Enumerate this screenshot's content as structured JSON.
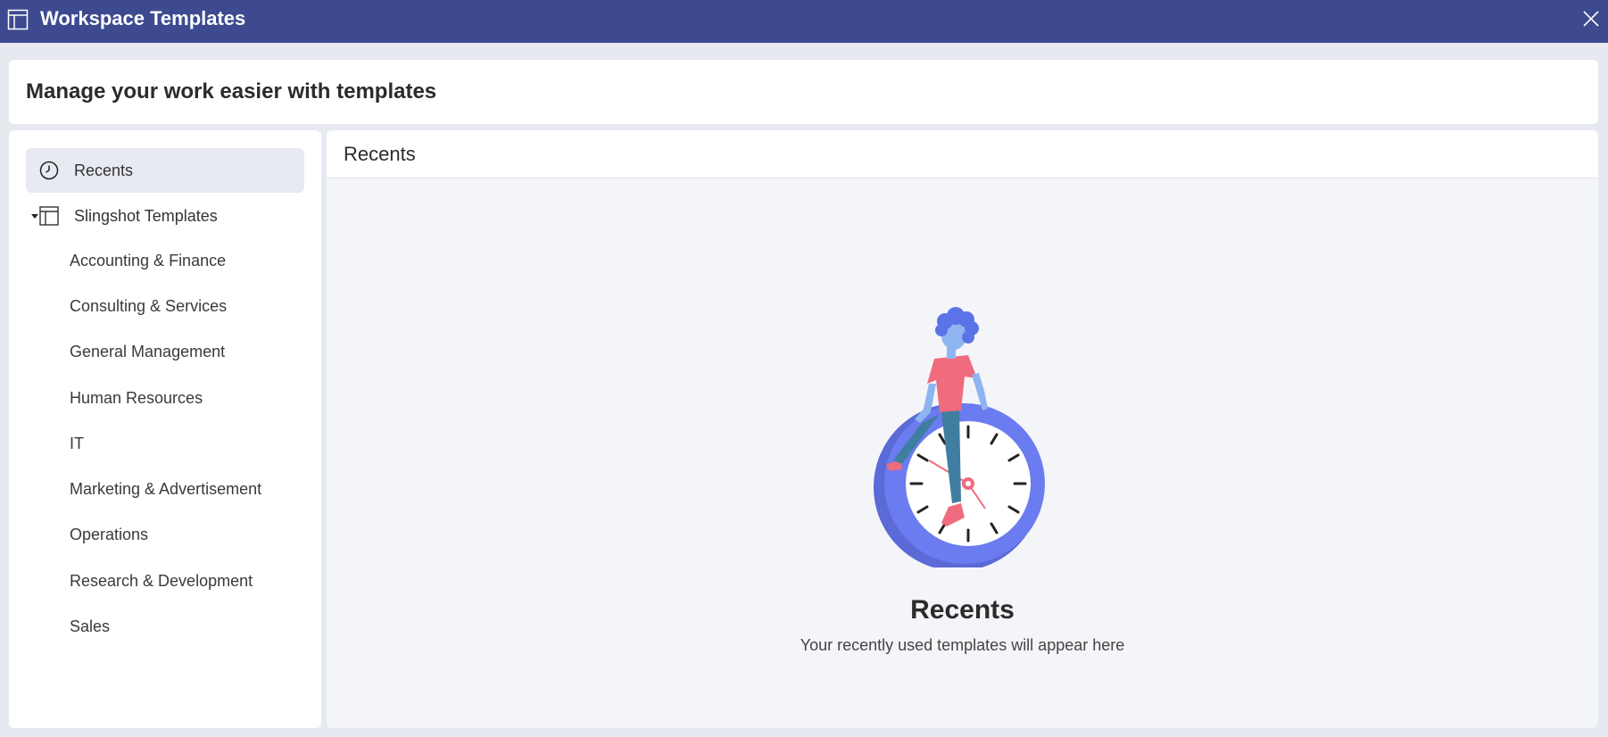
{
  "window": {
    "title": "Workspace Templates",
    "app_icon": "template-layout-icon",
    "close_icon": "close-icon"
  },
  "headline": "Manage your work easier with templates",
  "sidebar": {
    "recents": {
      "label": "Recents",
      "icon": "clock-icon",
      "active": true
    },
    "group": {
      "label": "Slingshot Templates",
      "icon": "template-layout-icon",
      "expanded": true
    },
    "categories": [
      "Accounting & Finance",
      "Consulting & Services",
      "General Management",
      "Human Resources",
      "IT",
      "Marketing & Advertisement",
      "Operations",
      "Research & Development",
      "Sales"
    ]
  },
  "main": {
    "title": "Recents",
    "empty_state": {
      "title": "Recents",
      "subtitle": "Your recently used templates will appear here",
      "illustration": "person-sitting-on-clock-illustration"
    }
  },
  "colors": {
    "titlebar": "#3d4a8f",
    "clock_ring": "#6b7cf0",
    "shirt": "#f06b7d",
    "skin": "#8fb5f0"
  }
}
